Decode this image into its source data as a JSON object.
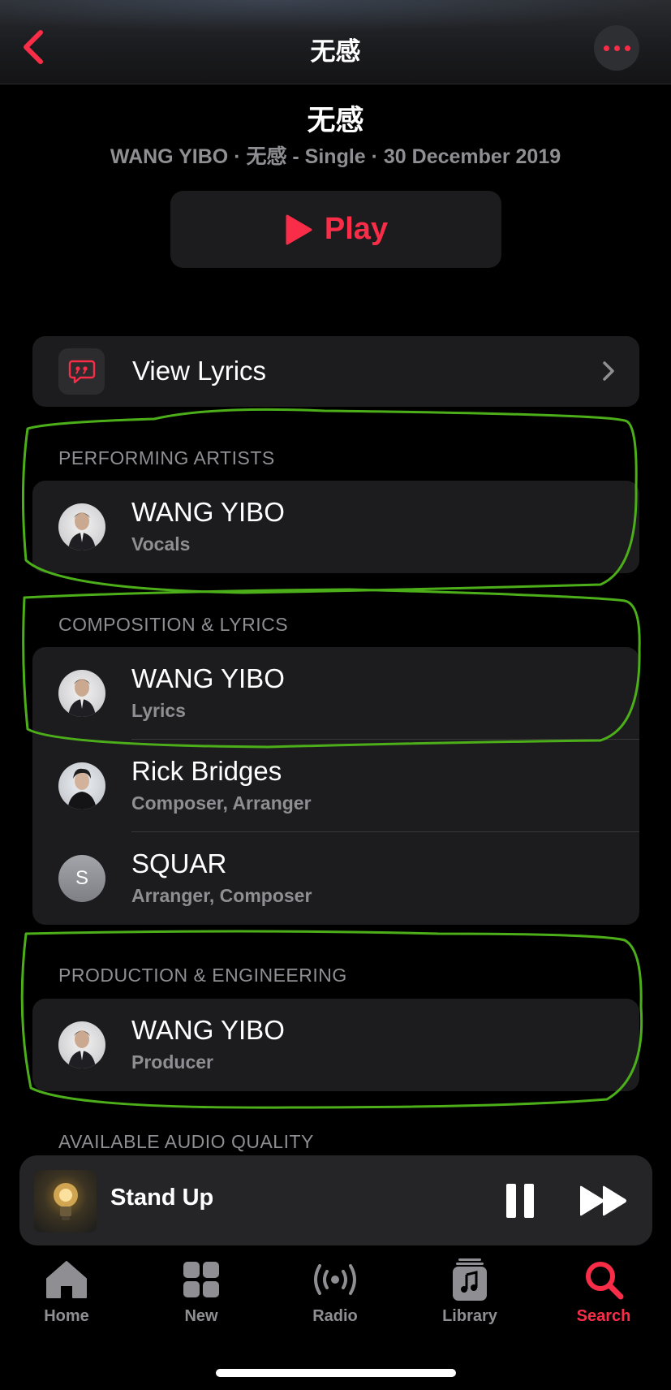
{
  "header": {
    "title": "无感"
  },
  "album": {
    "title": "无感",
    "subtitle": "WANG YIBO · 无感 - Single · 30 December 2019",
    "play_label": "Play"
  },
  "lyrics_row": {
    "label": "View Lyrics"
  },
  "sections": {
    "performing_artists": {
      "header": "PERFORMING ARTISTS",
      "credits": [
        {
          "name": "WANG YIBO",
          "role": "Vocals"
        }
      ]
    },
    "composition": {
      "header": "COMPOSITION & LYRICS",
      "credits": [
        {
          "name": "WANG YIBO",
          "role": "Lyrics"
        },
        {
          "name": "Rick Bridges",
          "role": "Composer, Arranger"
        },
        {
          "name": "SQUAR",
          "role": "Arranger, Composer",
          "initial": "S"
        }
      ]
    },
    "production": {
      "header": "PRODUCTION & ENGINEERING",
      "credits": [
        {
          "name": "WANG YIBO",
          "role": "Producer"
        }
      ]
    },
    "audio_quality": {
      "header": "AVAILABLE AUDIO QUALITY"
    }
  },
  "mini_player": {
    "track_title": "Stand Up"
  },
  "tabs": [
    {
      "label": "Home",
      "icon": "house-icon",
      "active": false
    },
    {
      "label": "New",
      "icon": "grid-icon",
      "active": false
    },
    {
      "label": "Radio",
      "icon": "broadcast-icon",
      "active": false
    },
    {
      "label": "Library",
      "icon": "music-library-icon",
      "active": false
    },
    {
      "label": "Search",
      "icon": "search-icon",
      "active": true
    }
  ],
  "colors": {
    "accent": "#fa2d48",
    "annotation": "#4caf1a",
    "card": "#1c1c1e",
    "secondary_text": "#8e8e93"
  }
}
